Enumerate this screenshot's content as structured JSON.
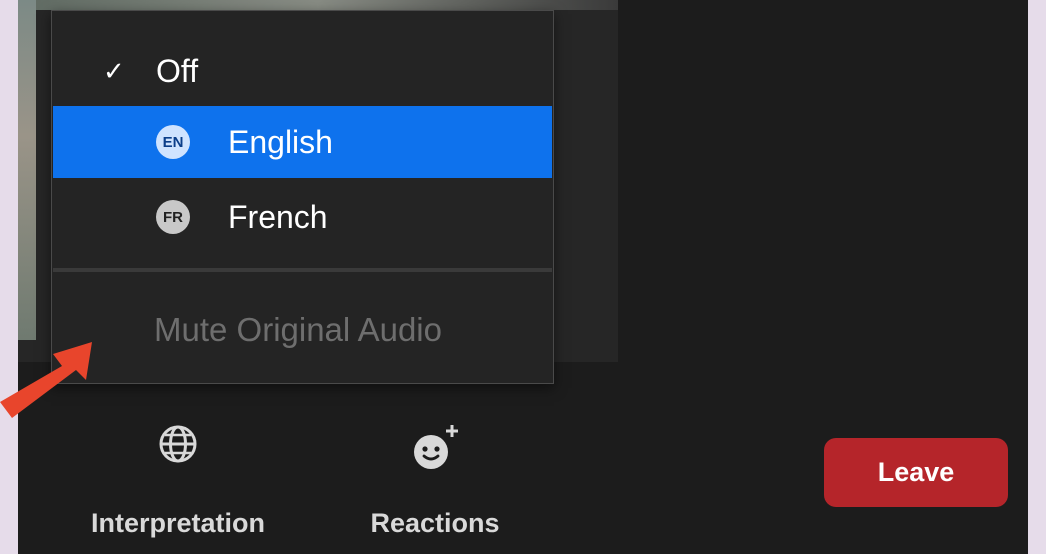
{
  "menu": {
    "off": {
      "check": "✓",
      "label": "Off"
    },
    "languages": [
      {
        "code": "EN",
        "label": "English",
        "selected": true
      },
      {
        "code": "FR",
        "label": "French",
        "selected": false
      }
    ],
    "mute_label": "Mute Original Audio"
  },
  "toolbar": {
    "interpretation_label": "Interpretation",
    "reactions_label": "Reactions",
    "leave_label": "Leave"
  },
  "colors": {
    "highlight": "#0e72ed",
    "leave": "#b5252a",
    "arrow": "#e8452c"
  }
}
